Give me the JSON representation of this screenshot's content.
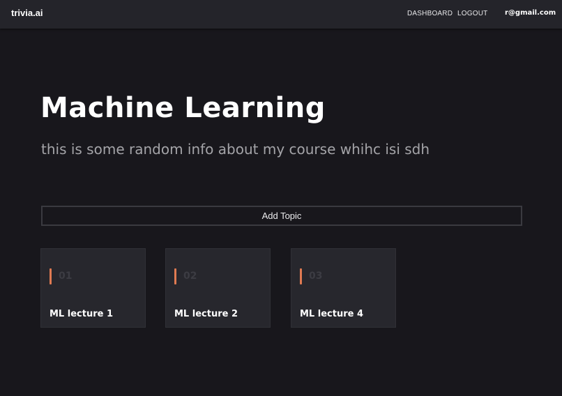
{
  "navbar": {
    "brand": "trivia.ai",
    "links": [
      {
        "label": "DASHBOARD"
      },
      {
        "label": "LOGOUT"
      }
    ],
    "user_email": "r@gmail.com"
  },
  "course": {
    "title": "Machine Learning",
    "description": "this is some random info about my course whihc isi sdh"
  },
  "add_topic": {
    "label": "Add Topic"
  },
  "topics": [
    {
      "number": "01",
      "name": "ML lecture 1"
    },
    {
      "number": "02",
      "name": "ML lecture 2"
    },
    {
      "number": "03",
      "name": "ML lecture 4"
    }
  ],
  "colors": {
    "background": "#18171c",
    "navbar": "#24242a",
    "card": "#27272d",
    "accent": "#e07a52"
  }
}
